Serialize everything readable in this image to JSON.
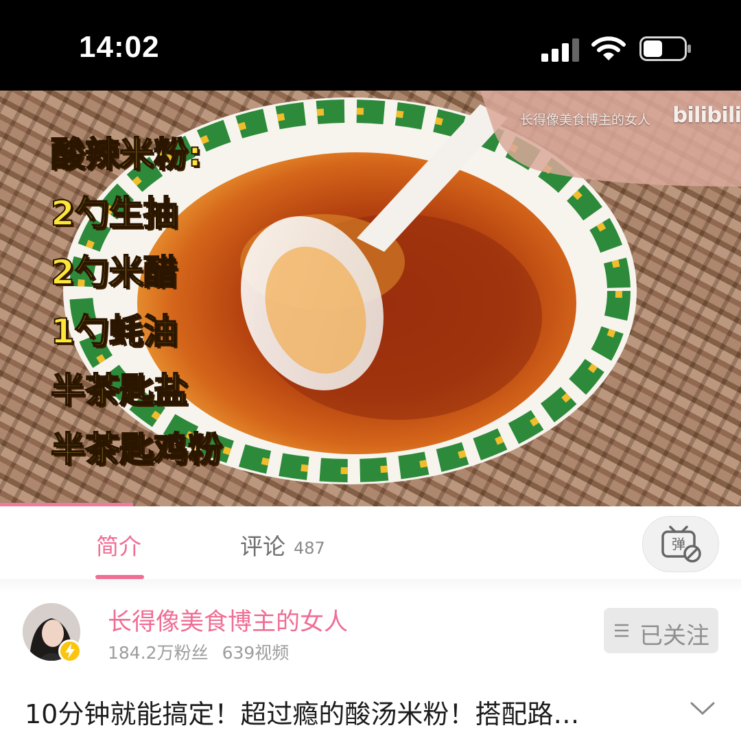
{
  "status_bar": {
    "time": "14:02",
    "icons": [
      "cellular-signal-icon",
      "wifi-icon",
      "battery-icon"
    ]
  },
  "video": {
    "watermark_text": "长得像美食博主的女人",
    "watermark_logo": "bilibili",
    "overlay_lines": [
      "酸辣米粉:",
      "2勺生抽",
      "2勺米醋",
      "1勺蚝油",
      "半茶匙盐",
      "半茶匙鸡粉"
    ],
    "progress": 0.18
  },
  "tabs": {
    "intro_label": "简介",
    "comments_label": "评论",
    "comments_count": "487",
    "danmaku_icon": "danmaku-toggle-icon"
  },
  "uploader": {
    "name": "长得像美食博主的女人",
    "followers": "184.2万粉丝",
    "videos": "639视频",
    "follow_label": "已关注"
  },
  "video_info": {
    "title": "10分钟就能搞定！超过瘾的酸汤米粉！搭配路…"
  },
  "colors": {
    "accent_pink": "#f06d94",
    "overlay_yellow": "#ffe63a"
  }
}
